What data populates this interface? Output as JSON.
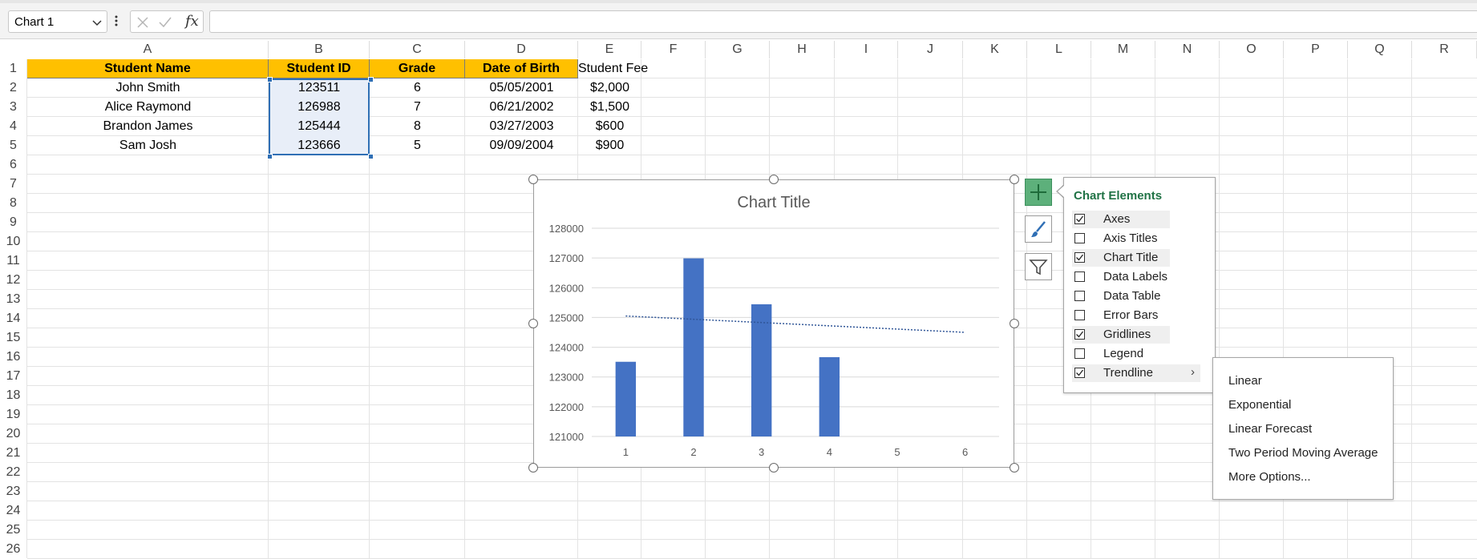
{
  "formula_bar": {
    "name_box": "Chart 1",
    "fx_label": "fx",
    "formula": ""
  },
  "columns": [
    "A",
    "B",
    "C",
    "D",
    "E",
    "F",
    "G",
    "H",
    "I",
    "J",
    "K",
    "L",
    "M",
    "N",
    "O",
    "P",
    "Q",
    "R"
  ],
  "rows": [
    "1",
    "2",
    "3",
    "4",
    "5",
    "6",
    "7",
    "8",
    "9",
    "10",
    "11",
    "12",
    "13",
    "14",
    "15",
    "16",
    "17",
    "18",
    "19",
    "20",
    "21",
    "22",
    "23",
    "24",
    "25",
    "26"
  ],
  "table": {
    "headers": [
      "Student Name",
      "Student ID",
      "Grade",
      "Date of Birth",
      "Student Fee"
    ],
    "rows": [
      [
        "John Smith",
        "123511",
        "6",
        "05/05/2001",
        "$2,000"
      ],
      [
        "Alice Raymond",
        "126988",
        "7",
        "06/21/2002",
        "$1,500"
      ],
      [
        "Brandon James",
        "125444",
        "8",
        "03/27/2003",
        "$600"
      ],
      [
        "Sam Josh",
        "123666",
        "5",
        "09/09/2004",
        "$900"
      ]
    ],
    "header_color": "#ffc000"
  },
  "chart_data": {
    "type": "bar",
    "title": "Chart Title",
    "categories": [
      "1",
      "2",
      "3",
      "4",
      "5",
      "6"
    ],
    "series": [
      {
        "values": [
          123511,
          126988,
          125444,
          123666
        ]
      }
    ],
    "ylim": [
      121000,
      128000
    ],
    "yticks": [
      "128000",
      "127000",
      "126000",
      "125000",
      "124000",
      "123000",
      "122000",
      "121000"
    ],
    "trendline": {
      "type": "linear",
      "from": 125050,
      "to": 124500
    },
    "grid": true,
    "legend": false,
    "bar_color": "#4472c4"
  },
  "chart_elements": {
    "title": "Chart Elements",
    "items": [
      {
        "label": "Axes",
        "checked": true
      },
      {
        "label": "Axis Titles",
        "checked": false
      },
      {
        "label": "Chart Title",
        "checked": true
      },
      {
        "label": "Data Labels",
        "checked": false
      },
      {
        "label": "Data Table",
        "checked": false
      },
      {
        "label": "Error Bars",
        "checked": false
      },
      {
        "label": "Gridlines",
        "checked": true
      },
      {
        "label": "Legend",
        "checked": false
      },
      {
        "label": "Trendline",
        "checked": true
      }
    ]
  },
  "trendline_menu": [
    "Linear",
    "Exponential",
    "Linear Forecast",
    "Two Period Moving Average",
    "More Options..."
  ],
  "side_buttons": [
    "chart-elements-plus-icon",
    "chart-styles-brush-icon",
    "chart-filters-funnel-icon"
  ]
}
